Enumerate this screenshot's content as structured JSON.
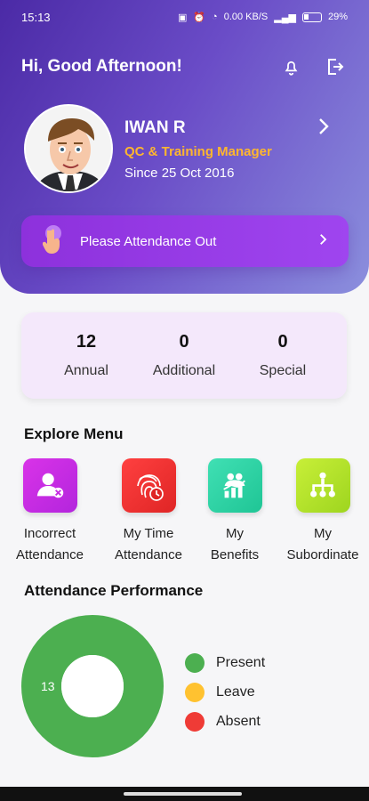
{
  "status_bar": {
    "time": "15:13",
    "network_speed": "0.00 KB/S",
    "battery": "29%"
  },
  "header": {
    "greeting": "Hi, Good Afternoon!"
  },
  "profile": {
    "name": "IWAN R",
    "role": "QC & Training Manager",
    "since": "Since 25 Oct 2016"
  },
  "attendance_button": {
    "label": "Please Attendance Out"
  },
  "leave_summary": [
    {
      "count": "12",
      "label": "Annual"
    },
    {
      "count": "0",
      "label": "Additional"
    },
    {
      "count": "0",
      "label": "Special"
    }
  ],
  "explore_menu": {
    "title": "Explore Menu",
    "items": [
      {
        "line1": "Incorrect",
        "line2": "Attendance",
        "icon": "user-remove-icon",
        "color": "#d933e8"
      },
      {
        "line1": "My Time",
        "line2": "Attendance",
        "icon": "fingerprint-clock-icon",
        "color": "#ef2f2f"
      },
      {
        "line1": "My",
        "line2": "Benefits",
        "icon": "benefits-icon",
        "color": "#24d1a0"
      },
      {
        "line1": "My",
        "line2": "Subordinate",
        "icon": "org-chart-icon",
        "color": "#a7d91f"
      }
    ]
  },
  "attendance_performance": {
    "title": "Attendance Performance",
    "legend": [
      {
        "label": "Present",
        "color": "#4caf50"
      },
      {
        "label": "Leave",
        "color": "#ffc230"
      },
      {
        "label": "Absent",
        "color": "#ef3b36"
      }
    ]
  },
  "chart_data": {
    "type": "pie",
    "categories": [
      "Present",
      "Leave",
      "Absent"
    ],
    "values": [
      13,
      0,
      0
    ],
    "colors": [
      "#4caf50",
      "#ffc230",
      "#ef3b36"
    ],
    "slice_labels": [
      "13"
    ]
  },
  "colors": {
    "hero_start": "#4b2aa6",
    "hero_end": "#8b8fdd",
    "accent_purple": "#9f45ef",
    "role_orange": "#ffb62e"
  }
}
